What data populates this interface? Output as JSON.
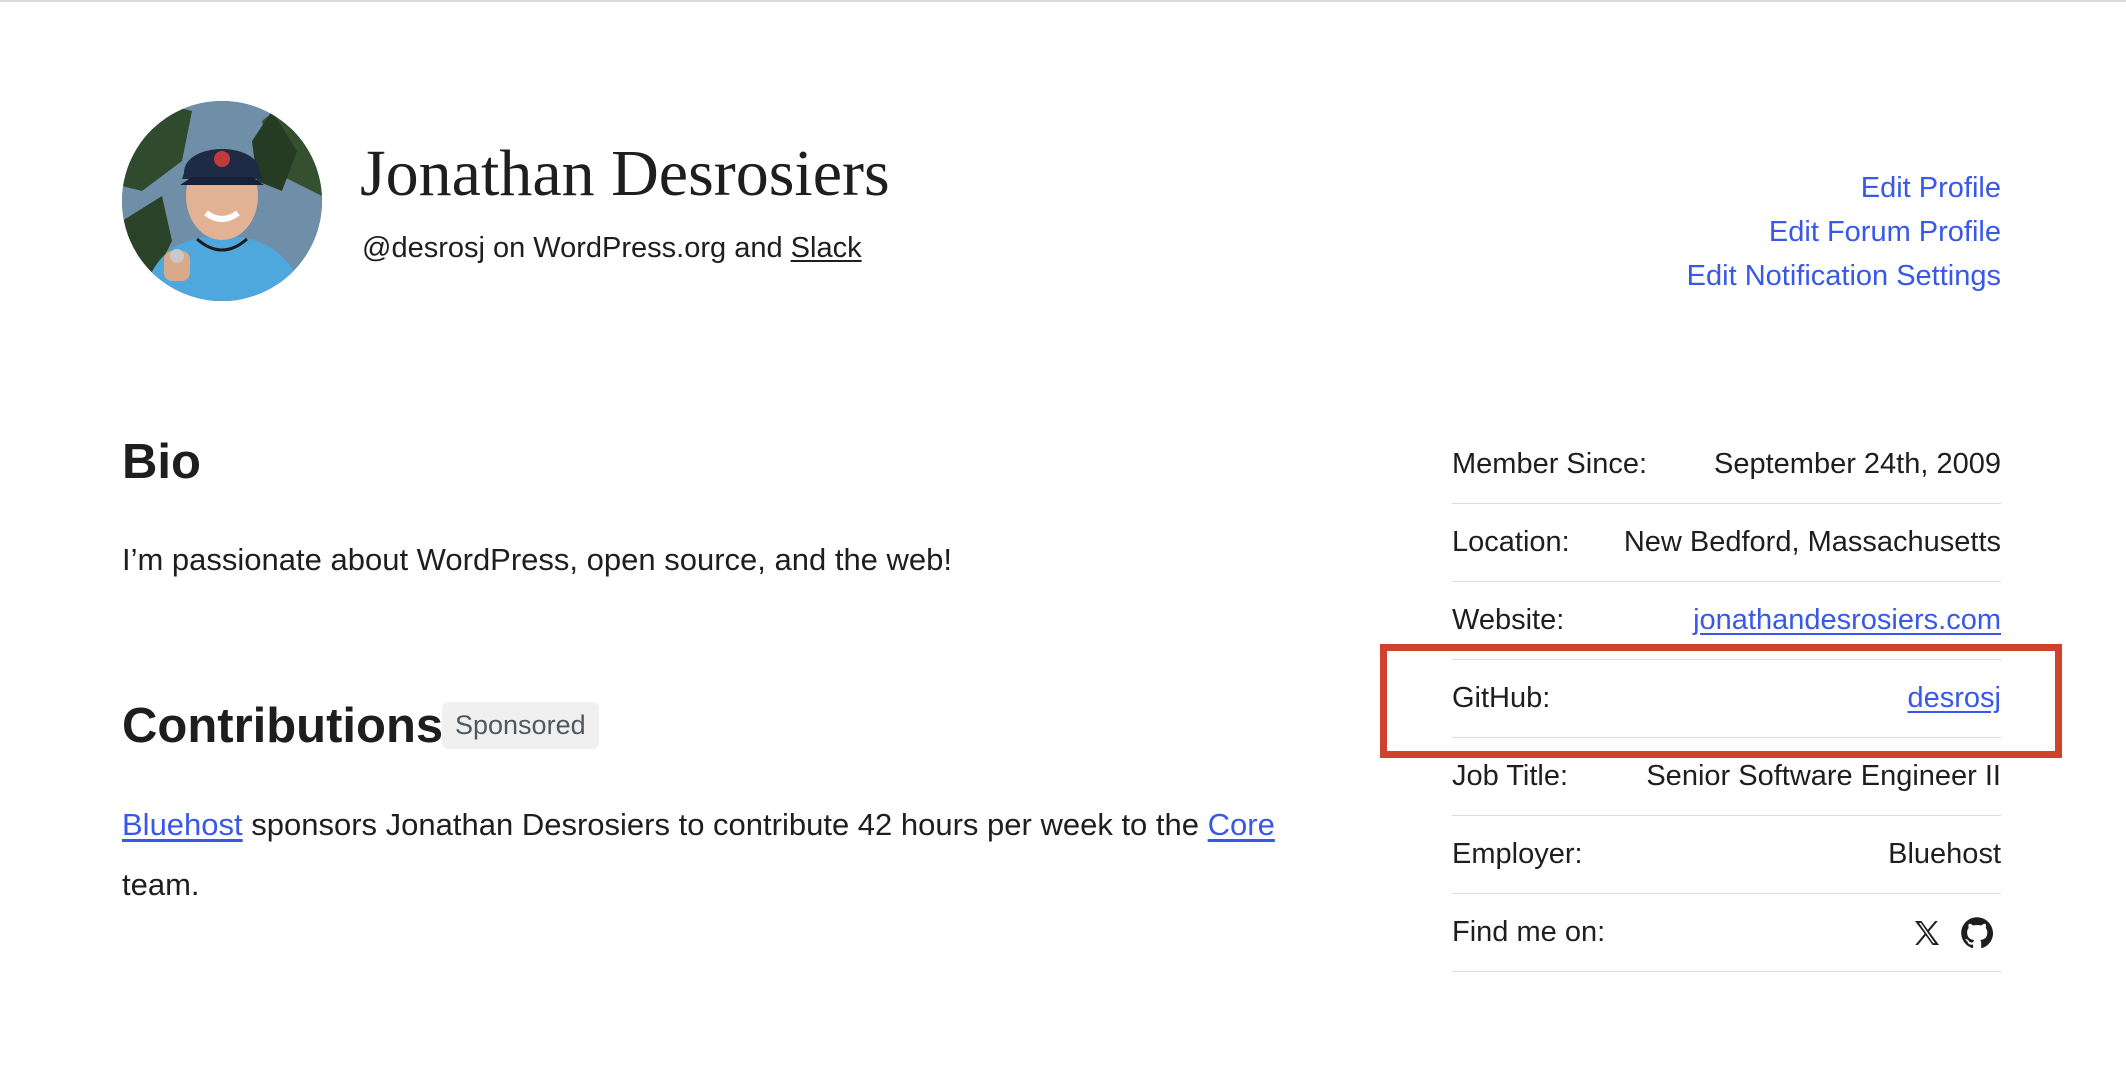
{
  "profile": {
    "name": "Jonathan Desrosiers",
    "handle_prefix": "@desrosj on WordPress.org and ",
    "slack_label": "Slack",
    "avatar_icon": "user-avatar-photo"
  },
  "edit_links": [
    "Edit Profile",
    "Edit Forum Profile",
    "Edit Notification Settings"
  ],
  "bio": {
    "heading": "Bio",
    "text": "I’m passionate about WordPress, open source, and the web!"
  },
  "contributions": {
    "heading": "Contributions",
    "badge": "Sponsored",
    "sponsor_link": "Bluehost",
    "text_mid": " sponsors Jonathan Desrosiers to contribute 42 hours per week to the ",
    "team_link": "Core",
    "text_end": " team."
  },
  "details": {
    "member_since": {
      "label": "Member Since:",
      "value": "September 24th, 2009"
    },
    "location": {
      "label": "Location:",
      "value": "New Bedford, Massachusetts"
    },
    "website": {
      "label": "Website:",
      "value": "jonathandesrosiers.com"
    },
    "github": {
      "label": "GitHub:",
      "value": "desrosj"
    },
    "job_title": {
      "label": "Job Title:",
      "value": "Senior Software Engineer II"
    },
    "employer": {
      "label": "Employer:",
      "value": "Bluehost"
    },
    "find_me": {
      "label": "Find me on:",
      "icons": [
        "x-icon",
        "github-icon"
      ]
    }
  },
  "colors": {
    "link": "#3858e9",
    "highlight": "#d0412e",
    "divider": "#dcdcde",
    "badge_bg": "#f0f0f1"
  }
}
